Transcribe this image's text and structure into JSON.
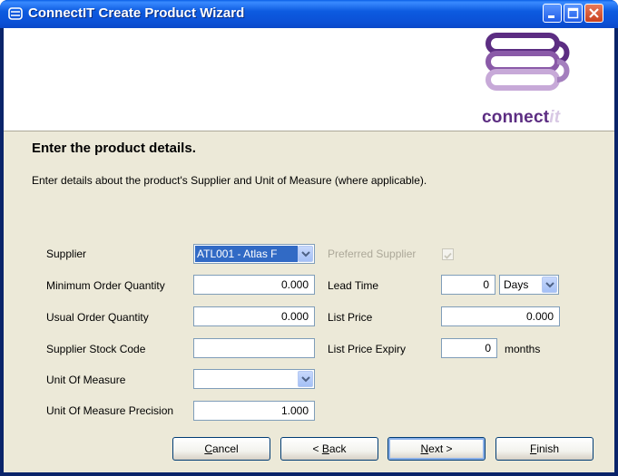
{
  "window": {
    "title": "ConnectIT Create Product Wizard"
  },
  "logo": {
    "text_main": "connect",
    "text_suffix": "it",
    "colors": {
      "purple": "#5c2d82",
      "light": "#d8c8e4"
    }
  },
  "page": {
    "heading": "Enter the product details.",
    "description": "Enter details about the product's Supplier and Unit of Measure (where applicable)."
  },
  "form": {
    "supplier": {
      "label": "Supplier",
      "value": "ATL001 - Atlas F"
    },
    "preferred_supplier": {
      "label": "Preferred Supplier",
      "checked": true,
      "enabled": false
    },
    "min_order_qty": {
      "label": "Minimum Order Quantity",
      "value": "0.000"
    },
    "lead_time": {
      "label": "Lead Time",
      "value": "0",
      "unit": "Days"
    },
    "usual_order_qty": {
      "label": "Usual Order Quantity",
      "value": "0.000"
    },
    "list_price": {
      "label": "List Price",
      "value": "0.000"
    },
    "supplier_stock_code": {
      "label": "Supplier Stock Code",
      "value": ""
    },
    "list_price_expiry": {
      "label": "List Price Expiry",
      "value": "0",
      "unit": "months"
    },
    "unit_of_measure": {
      "label": "Unit Of Measure",
      "value": ""
    },
    "uom_precision": {
      "label": "Unit Of Measure Precision",
      "value": "1.000"
    }
  },
  "buttons": {
    "cancel": {
      "accel": "C",
      "rest": "ancel"
    },
    "back": {
      "prefix": "< ",
      "accel": "B",
      "rest": "ack"
    },
    "next": {
      "accel": "N",
      "rest": "ext >"
    },
    "finish": {
      "accel": "F",
      "rest": "inish"
    }
  }
}
